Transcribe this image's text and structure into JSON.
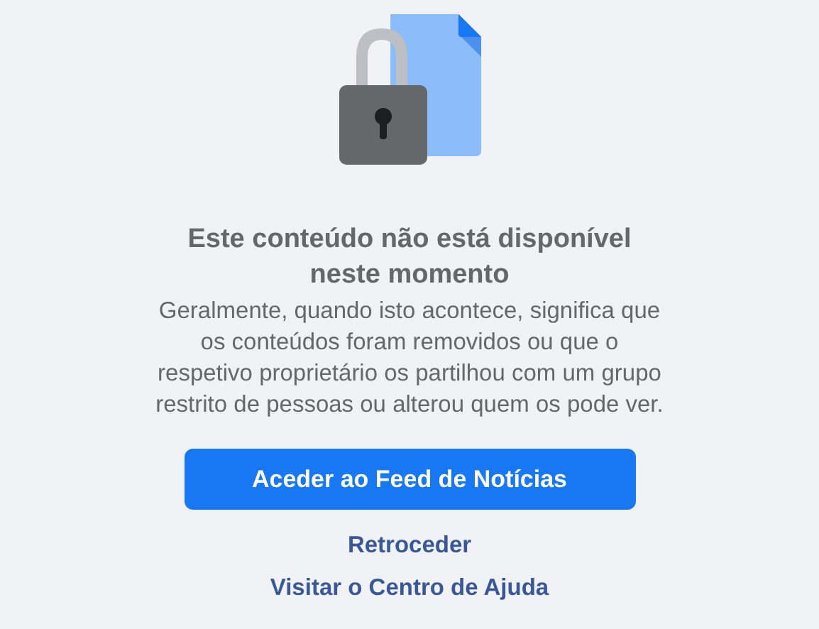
{
  "heading": "Este conteúdo não está disponível neste momento",
  "message": "Geralmente, quando isto acontece, significa que os conteúdos foram removidos ou que o respetivo proprietário os partilhou com um grupo restrito de pessoas ou alterou quem os pode ver.",
  "primary_button": "Aceder ao Feed de Notícias",
  "links": [
    {
      "label": "Retroceder"
    },
    {
      "label": "Visitar o Centro de Ajuda"
    }
  ]
}
